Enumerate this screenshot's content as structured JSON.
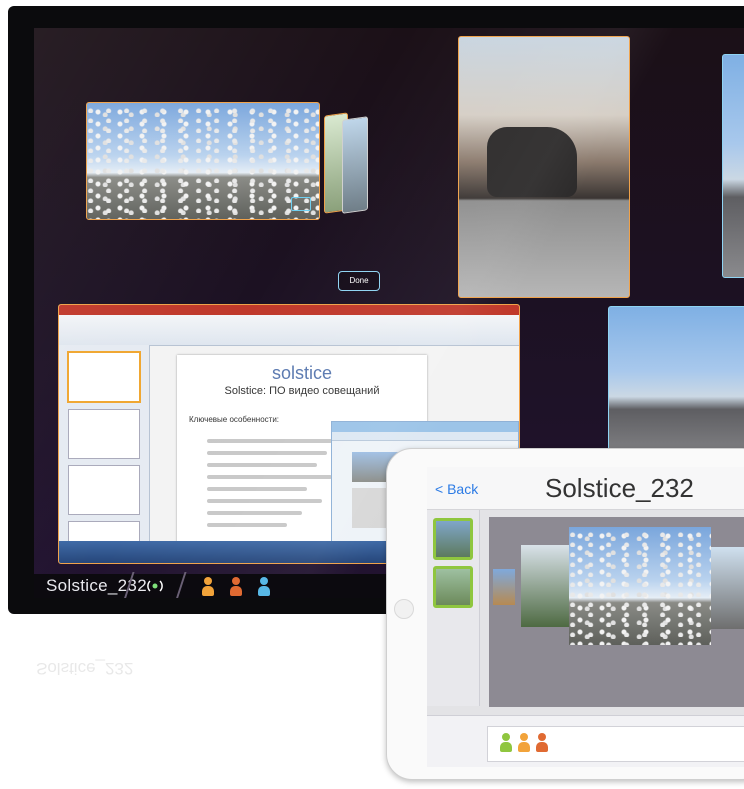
{
  "display": {
    "ppt_slide": {
      "logo": "solstice",
      "heading": "Solstice: ПО видео совещаний",
      "subheading": "Ключевые особенности:"
    },
    "done_button": "Done",
    "status_bar": {
      "room_name": "Solstice_232"
    },
    "participant_colors": [
      "#f2a33a",
      "#e06a32",
      "#58b8e6"
    ]
  },
  "tablet": {
    "back_label": "< Back",
    "room_title": "Solstice_232",
    "participant_colors": [
      "#8fc63f",
      "#f2a33a",
      "#e06a32"
    ]
  }
}
